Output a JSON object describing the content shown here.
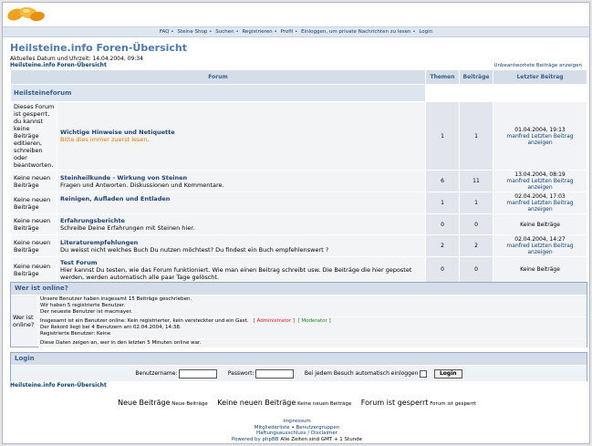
{
  "nav": {
    "faq": "FAQ",
    "shop": "Steine Shop",
    "search": "Suchen",
    "register": "Registrieren",
    "profile": "Profil",
    "messages": "Einloggen, um private Nachrichten zu lesen",
    "login": "Login"
  },
  "page": {
    "title": "Heilsteine.info Foren-Übersicht",
    "datetime": "Aktuelles Datum und Uhrzeit: 14.04.2004, 09:34",
    "breadcrumb": "Heilsteine.info Foren-Übersicht",
    "unanswered": "Unbeantwortete Beiträge anzeigen"
  },
  "table": {
    "col_forum": "Forum",
    "col_topics": "Themen",
    "col_posts": "Beiträge",
    "col_last": "Letzter Beitrag",
    "category": "Heilsteineforum",
    "forums": [
      {
        "icon_text": "Dieses Forum ist gesperrt, du kannst keine Beiträge editieren, schreiben oder beantworten.",
        "name": "Wichtige Hinweise und Netiquette",
        "desc": "Bitte dies immer zuerst lesen.",
        "topics": "1",
        "posts": "1",
        "last_date": "01.04.2004, 19:13",
        "last_by": "manfred Letzten Beitrag anzeigen"
      },
      {
        "icon_text": "Keine neuen Beiträge",
        "name": "Steinheilkunde - Wirkung von Steinen",
        "desc": "Fragen und Antworten. Diskussionen und Kommentare.",
        "topics": "6",
        "posts": "11",
        "last_date": "13.04.2004, 08:19",
        "last_by": "manfred Letzten Beitrag anzeigen"
      },
      {
        "icon_text": "Keine neuen Beiträge",
        "name": "Reinigen, Aufladen und Entladen",
        "desc": "",
        "topics": "1",
        "posts": "1",
        "last_date": "02.04.2004, 17:03",
        "last_by": "manfred Letzten Beitrag anzeigen"
      },
      {
        "icon_text": "Keine neuen Beiträge",
        "name": "Erfahrungsberichte",
        "desc": "Schreibe Deine Erfahrungen mit Steinen hier.",
        "topics": "0",
        "posts": "0",
        "last_date": "",
        "last_by": "Keine Beiträge"
      },
      {
        "icon_text": "Keine neuen Beiträge",
        "name": "Literaturempfehlungen",
        "desc": "Du weisst nicht welches Buch Du nutzen möchtest? Du findest ein Buch empfehlenswert ?",
        "topics": "2",
        "posts": "2",
        "last_date": "02.04.2004, 14:27",
        "last_by": "manfred Letzten Beitrag anzeigen"
      },
      {
        "icon_text": "Keine neuen Beiträge",
        "name": "Test Forum",
        "desc": "Hier kannst Du testen, wie das Forum funktioniert. Wie man einen Beitrag schreibt usw. Die Beiträge die hier gepostet werden, werden automatisch alle paar Tage gelöscht.",
        "topics": "0",
        "posts": "0",
        "last_date": "",
        "last_by": "Keine Beiträge"
      }
    ]
  },
  "online": {
    "title": "Wer ist online?",
    "label": "Wer ist online?",
    "line1": "Unsere Benutzer haben insgesamt 15 Beiträge geschrieben.",
    "line2": "Wir haben 5 registrierte Benutzer.",
    "line3": "Der neueste Benutzer ist macmayer.",
    "line4": "Insgesamt ist ein Benutzer online: Kein registrierter, kein versteckter und ein Gast.",
    "admin": "[ Administrator ]",
    "mod": "[ Moderator ]",
    "line5": "Der Rekord liegt bei 4 Benutzern am 02.04.2004, 14:38.",
    "line6": "Registrierte Benutzer: Keine",
    "line7": "Diese Daten zeigen an, wer in den letzten 5 Minuten online war."
  },
  "login": {
    "title": "Login",
    "username_label": "Benutzername:",
    "password_label": "Passwort:",
    "auto_label": "Bei jedem Besuch automatisch einloggen",
    "button": "Login"
  },
  "legend": {
    "new_big": "Neue Beiträge",
    "new_small": "Neue Beiträge",
    "nonew_big": "Keine neuen Beiträge",
    "nonew_small": "Keine neuen Beiträge",
    "locked_big": "Forum ist gesperrt",
    "locked_small": "Forum ist gesperrt"
  },
  "footer": {
    "impressum": "Impressum",
    "members": "Mitgliederliste",
    "groups": "Benutzergruppen",
    "disclaimer": "Haftungsausschluss / Disclaimer",
    "powered": "Powered by phpBB",
    "timezone": "Alle Zeiten sind GMT + 1 Stunde"
  }
}
